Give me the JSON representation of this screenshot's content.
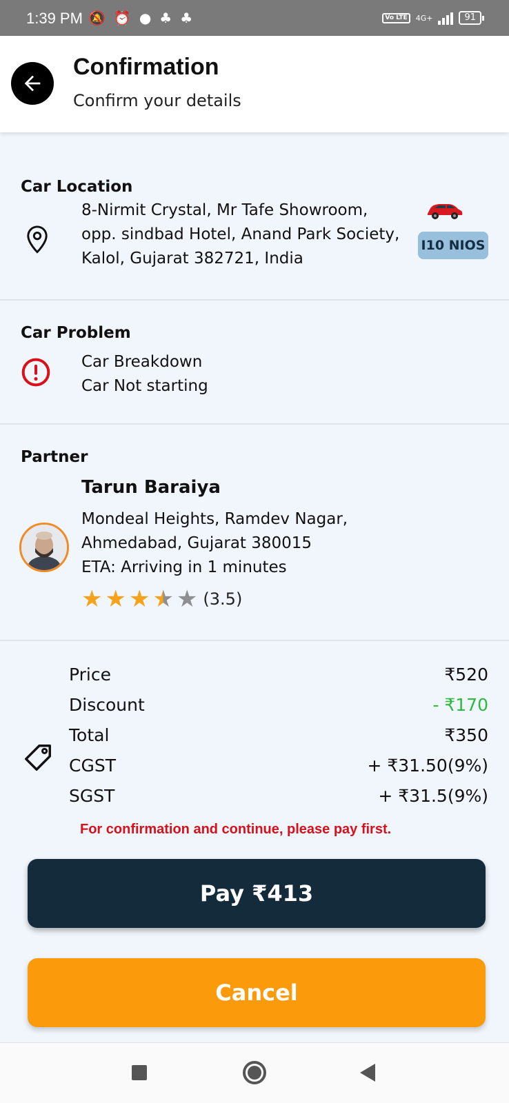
{
  "status_bar": {
    "time": "1:39 PM",
    "network": "4G+",
    "volte": "Vo LTE",
    "battery": "91"
  },
  "header": {
    "title": "Confirmation",
    "subtitle": "Confirm your details"
  },
  "car_location": {
    "label": "Car Location",
    "address_lines": [
      "8-Nirmit Crystal, Mr Tafe Showroom,",
      "opp. sindbad Hotel, Anand Park Society,",
      "Kalol, Gujarat 382721, India"
    ],
    "car_model": "I10 NIOS"
  },
  "car_problem": {
    "label": "Car Problem",
    "lines": [
      "Car Breakdown",
      "Car Not starting"
    ]
  },
  "partner": {
    "label": "Partner",
    "name": "Tarun Baraiya",
    "address_lines": [
      "Mondeal Heights, Ramdev Nagar,",
      "Ahmedabad, Gujarat 380015"
    ],
    "eta": "ETA: Arriving in 1 minutes",
    "rating": 3.5,
    "rating_text": "(3.5)"
  },
  "pricing": {
    "rows": [
      {
        "label": "Price",
        "value": "₹520"
      },
      {
        "label": "Discount",
        "value": "- ₹170"
      },
      {
        "label": "Total",
        "value": "₹350"
      },
      {
        "label": "CGST",
        "value": "+ ₹31.50(9%)"
      },
      {
        "label": "SGST",
        "value": "+ ₹31.5(9%)"
      }
    ],
    "warning": "For confirmation and continue, please pay first."
  },
  "actions": {
    "pay_label": "Pay ₹413",
    "cancel_label": "Cancel"
  },
  "colors": {
    "accent_orange": "#fb9a0b",
    "pay_dark": "#142b3c",
    "discount_green": "#2aba3e",
    "warning_red": "#d6111b",
    "star": "#f7a21b"
  }
}
